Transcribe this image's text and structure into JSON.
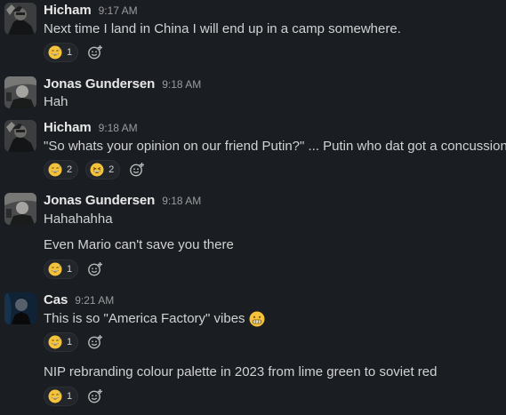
{
  "messages": [
    {
      "author": "Hicham",
      "time": "9:17 AM",
      "avatar": "avatar-hicham",
      "lines": [
        "Next time I land in China I will end up in a camp somewhere."
      ],
      "reactions": [
        {
          "emoji": "grinning-sweat-emoji",
          "count": "1"
        }
      ]
    },
    {
      "author": "Jonas Gundersen",
      "time": "9:18 AM",
      "avatar": "avatar-jonas",
      "lines": [
        "Hah"
      ],
      "reactions": []
    },
    {
      "author": "Hicham",
      "time": "9:18 AM",
      "avatar": "avatar-hicham",
      "lines": [
        "\"So whats your opinion on our friend Putin?\" ... Putin who dat got a concussion"
      ],
      "reactions": [
        {
          "emoji": "grinning-sweat-emoji",
          "count": "2"
        },
        {
          "emoji": "laughing-emoji",
          "count": "2"
        }
      ]
    },
    {
      "author": "Jonas Gundersen",
      "time": "9:18 AM",
      "avatar": "avatar-jonas",
      "lines": [
        "Hahahahha",
        "Even Mario can't save you there"
      ],
      "reactions": [
        {
          "emoji": "grinning-sweat-emoji",
          "count": "1"
        }
      ]
    },
    {
      "author": "Cas",
      "time": "9:21 AM",
      "avatar": "avatar-cas",
      "lines": [
        "This is so \"America Factory\" vibes",
        "NIP rebranding colour palette in 2023 from lime green to soviet red"
      ],
      "reactions": [
        {
          "emoji": "grinning-sweat-emoji",
          "count": "1"
        }
      ],
      "inline_emoji": "grimacing-emoji",
      "second_reactions": [
        {
          "emoji": "grinning-sweat-emoji",
          "count": "1"
        }
      ]
    }
  ],
  "colors": {
    "background": "#1a1d21",
    "text": "#d1d2d3",
    "author": "#e8e8e8",
    "timestamp": "#9a9b9d",
    "emoji_yellow": "#f5c33b"
  },
  "icons": {
    "add_reaction": "add-reaction-icon"
  }
}
